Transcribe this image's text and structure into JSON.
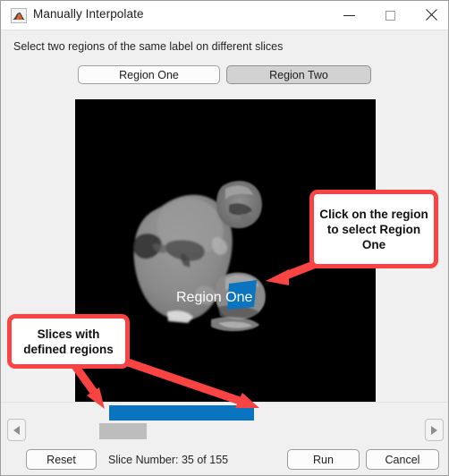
{
  "window": {
    "title": "Manually Interpolate",
    "icon": "matlab-membrane-icon",
    "controls": {
      "minimize": "minimize-icon",
      "maximize": "maximize-icon",
      "close": "close-icon"
    }
  },
  "instruction": "Select two regions of the same label on different slices",
  "region_buttons": [
    {
      "label": "Region One",
      "state": "normal"
    },
    {
      "label": "Region Two",
      "state": "pressed"
    }
  ],
  "canvas": {
    "overlay_label": "Region One",
    "background_color": "#000000",
    "highlight_color": "#0b74bf",
    "tissue_color": "#8c8c8c"
  },
  "slider": {
    "left_arrow": "chevron-left-icon",
    "right_arrow": "chevron-right-icon",
    "defined_regions_color": "#0b74bf",
    "thumb_color": "#bdbdbd"
  },
  "footer": {
    "reset_label": "Reset",
    "slice_status": "Slice Number: 35 of 155",
    "run_label": "Run",
    "cancel_label": "Cancel"
  },
  "annotations": {
    "accent_color": "#fa4343",
    "callout_right": "Click on the region to select Region One",
    "callout_left": "Slices with defined regions"
  }
}
